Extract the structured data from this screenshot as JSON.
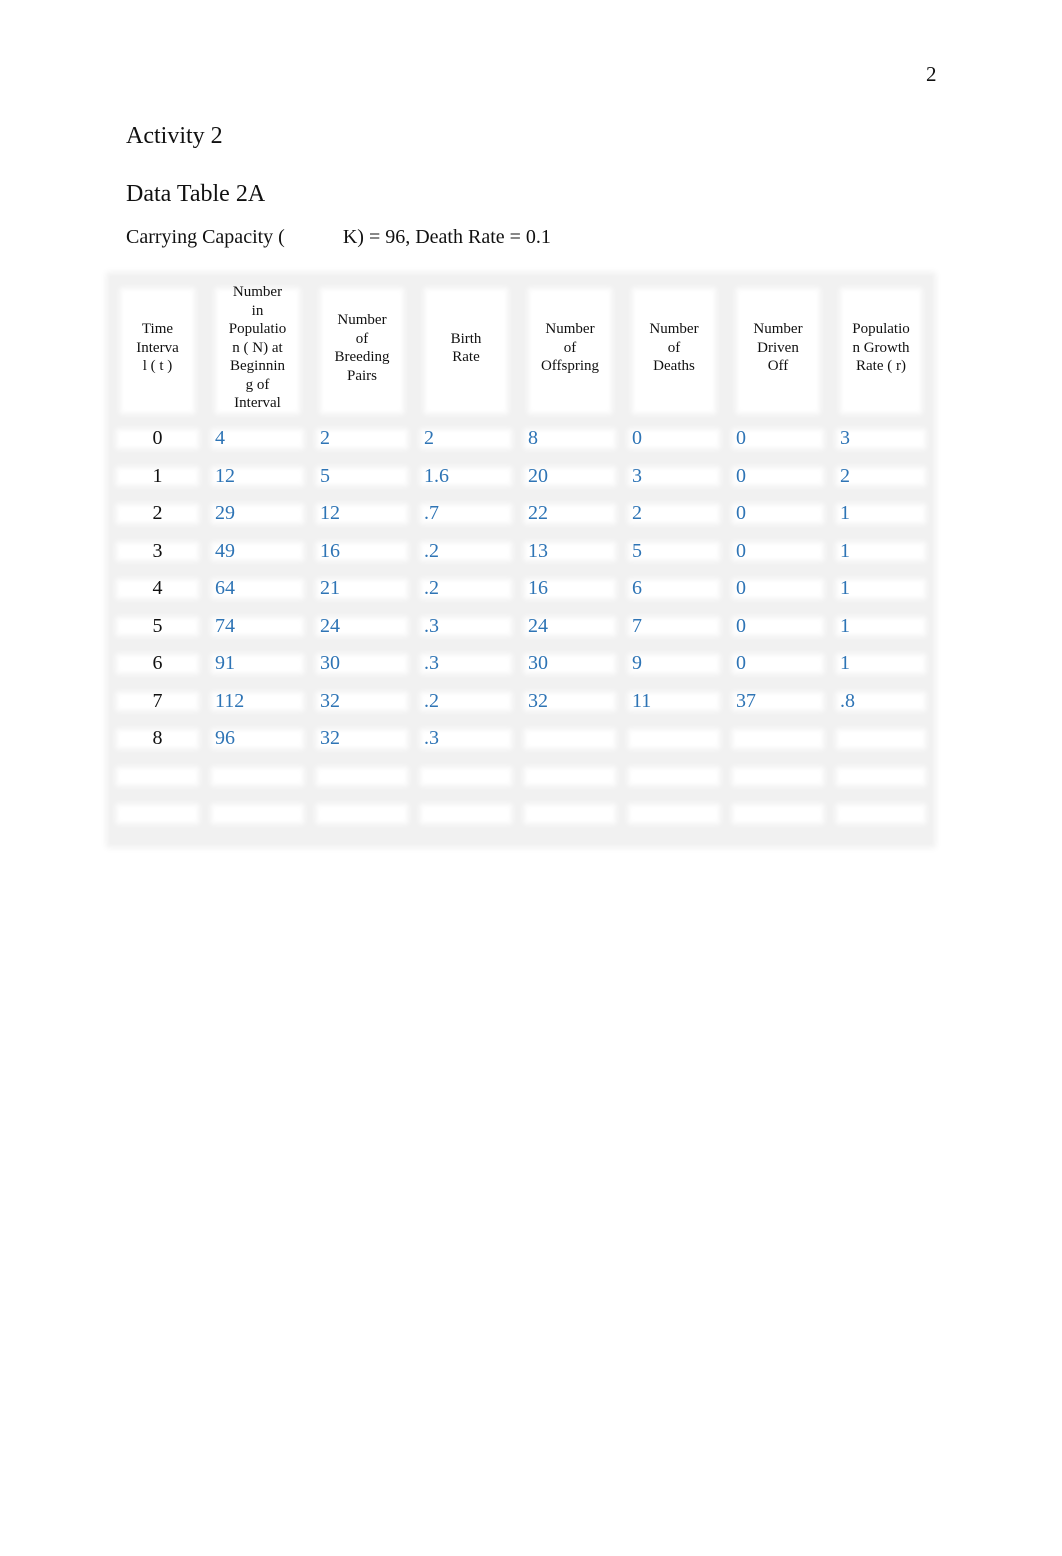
{
  "page_number": "2",
  "activity_heading": "Activity 2",
  "table_title": "Data Table 2A",
  "caption": {
    "prefix": "Carrying Capacity (",
    "suffix": "K) = 96, Death Rate = 0.1"
  },
  "table": {
    "headers": [
      "Time\nInterva\n l ( t )",
      "Number\n   in\nPopulatio\n n (  N) at\nBeginnin\n g of\nInterval",
      "Number\n   of\nBreeding\nPairs",
      "Birth\nRate",
      "Number\n   of\nOffspring",
      "Number\n   of\nDeaths",
      "Number\nDriven\n  Off",
      "Populatio\nn Growth\n  Rate (    r)"
    ],
    "rows": [
      {
        "t": "0",
        "cells": [
          "4",
          "2",
          "2",
          "8",
          "0",
          "0",
          "3"
        ]
      },
      {
        "t": "1",
        "cells": [
          "12",
          "5",
          "1.6",
          "20",
          "3",
          "0",
          "2"
        ]
      },
      {
        "t": "2",
        "cells": [
          "29",
          "12",
          ".7",
          "22",
          "2",
          "0",
          "1"
        ]
      },
      {
        "t": "3",
        "cells": [
          "49",
          "16",
          ".2",
          "13",
          "5",
          "0",
          "1"
        ]
      },
      {
        "t": "4",
        "cells": [
          "64",
          "21",
          ".2",
          "16",
          "6",
          "0",
          "1"
        ]
      },
      {
        "t": "5",
        "cells": [
          "74",
          "24",
          ".3",
          "24",
          "7",
          "0",
          "1"
        ]
      },
      {
        "t": "6",
        "cells": [
          "91",
          "30",
          ".3",
          "30",
          "9",
          "0",
          "1"
        ]
      },
      {
        "t": "7",
        "cells": [
          "112",
          "32",
          ".2",
          "32",
          "11",
          "37",
          ".8"
        ]
      },
      {
        "t": "8",
        "cells": [
          "96",
          "32",
          ".3",
          "",
          "",
          "",
          ""
        ]
      },
      {
        "t": "",
        "cells": [
          "",
          "",
          "",
          "",
          "",
          "",
          ""
        ]
      },
      {
        "t": "",
        "cells": [
          "",
          "",
          "",
          "",
          "",
          "",
          ""
        ]
      }
    ]
  },
  "colors": {
    "value_text": "#2e74b5",
    "table_bg": "#f1f1f1"
  }
}
